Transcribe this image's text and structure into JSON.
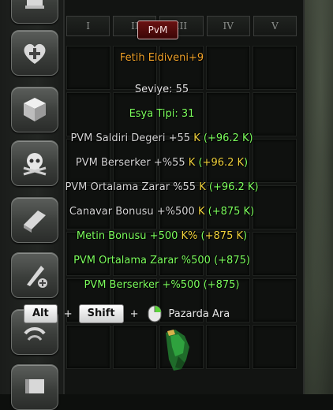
{
  "tabs": [
    {
      "label": "I"
    },
    {
      "label": "II"
    },
    {
      "label": "III"
    },
    {
      "label": "IV"
    },
    {
      "label": "V"
    }
  ],
  "tooltip": {
    "badge": "PvM",
    "title": "Fetih Eldiveni+9",
    "level": "Seviye: 55",
    "item_type": "Esya Tipi: 31",
    "bonuses": [
      {
        "label": "PVM Saldiri Degeri +55 ",
        "unit": "K",
        "extra_prefix": " (",
        "extra": "+96.2 K",
        "extra_suffix": ")"
      },
      {
        "label": "PVM Berserker +%55 ",
        "unit": "K",
        "extra_prefix": " (",
        "extra": "+96.2 K",
        "extra_suffix": ")"
      },
      {
        "label": "PVM Ortalama Zarar %55 ",
        "unit": "K",
        "extra_prefix": " (",
        "extra": "+96.2 K",
        "extra_suffix": ")"
      },
      {
        "label": "Canavar Bonusu +%500 ",
        "unit": "K",
        "extra_prefix": " (",
        "extra": "+875 K",
        "extra_suffix": ")"
      },
      {
        "label": "Metin Bonusu +500 ",
        "unit": "K%",
        "extra_prefix": " (",
        "extra": "+875 K",
        "extra_suffix": ")"
      },
      {
        "label": "PVM Ortalama Zarar %500 (+875)",
        "unit": "",
        "extra_prefix": "",
        "extra": "",
        "extra_suffix": ""
      },
      {
        "label": "PVM Berserker +%500 (+875)",
        "unit": "",
        "extra_prefix": "",
        "extra": "",
        "extra_suffix": ""
      }
    ]
  },
  "hint": {
    "key1": "Alt",
    "key2": "Shift",
    "plus": "+",
    "action": "Pazarda Ara"
  },
  "colors": {
    "title": "#f0a32a",
    "green": "#7dff5e",
    "yellow": "#f0d23c"
  }
}
